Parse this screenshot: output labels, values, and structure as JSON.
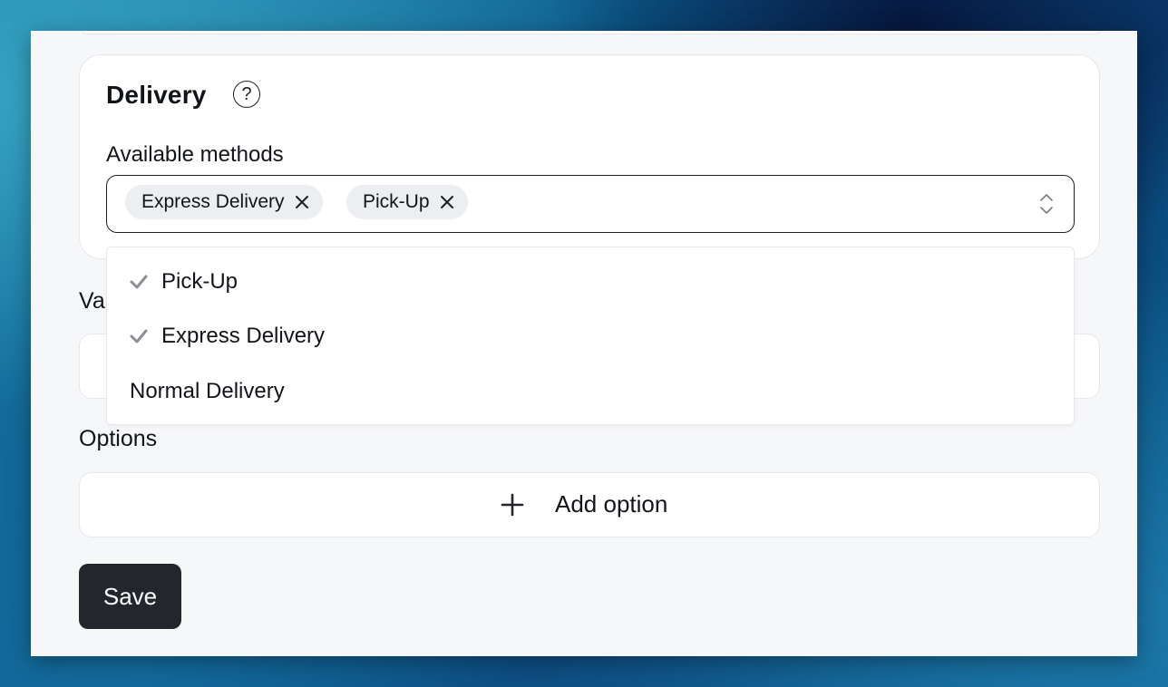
{
  "delivery": {
    "title": "Delivery",
    "help_icon": "question-circle-icon",
    "help_glyph": "?",
    "methods_label": "Available methods",
    "selected_chips": [
      {
        "label": "Express Delivery"
      },
      {
        "label": "Pick-Up"
      }
    ]
  },
  "dropdown": {
    "options": [
      {
        "label": "Pick-Up",
        "selected": true
      },
      {
        "label": "Express Delivery",
        "selected": true
      },
      {
        "label": "Normal Delivery",
        "selected": false
      }
    ]
  },
  "values_section": {
    "label_visible": "Va"
  },
  "options_section": {
    "label": "Options",
    "add_label": "Add option",
    "add_icon": "plus-icon"
  },
  "actions": {
    "save_label": "Save"
  },
  "colors": {
    "panel_bg": "#f6f7f9",
    "primary_button": "#23272d",
    "chip_bg": "#eceef1",
    "check_color": "#8a8d92"
  }
}
